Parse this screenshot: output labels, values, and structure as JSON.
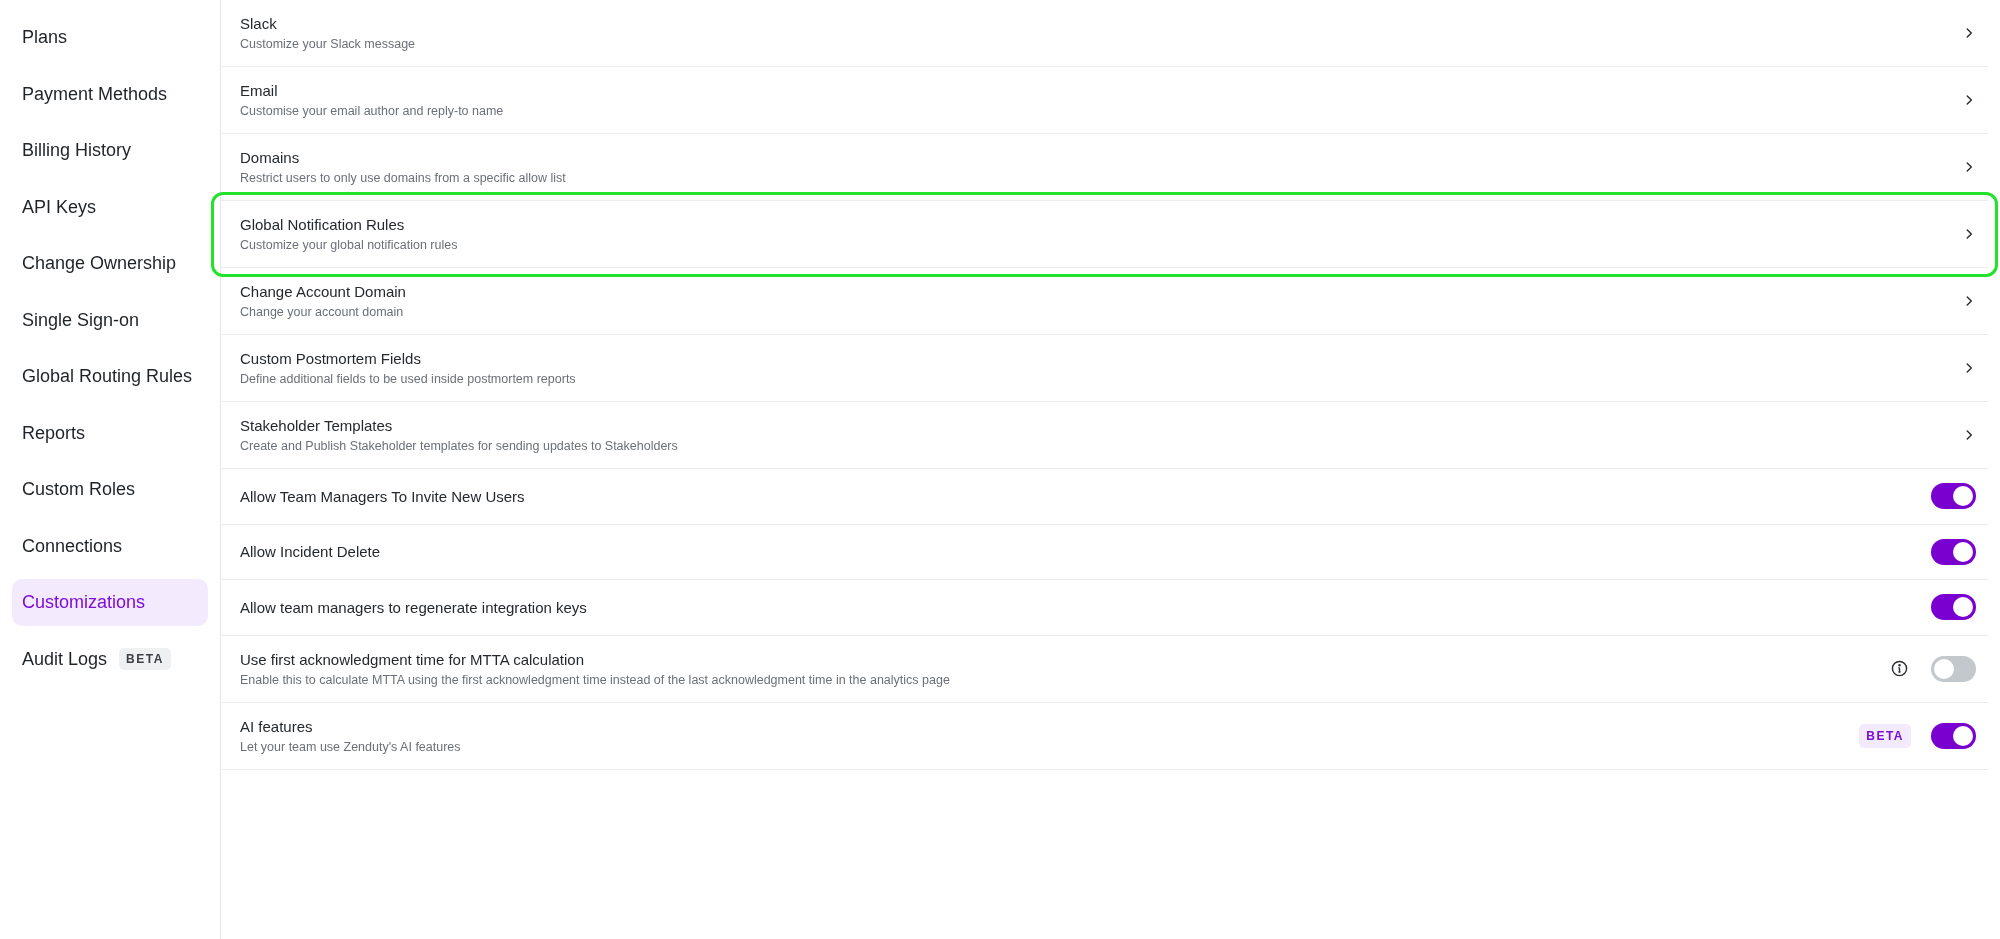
{
  "sidebar": {
    "items": [
      {
        "label": "Plans",
        "selected": false
      },
      {
        "label": "Payment Methods",
        "selected": false
      },
      {
        "label": "Billing History",
        "selected": false
      },
      {
        "label": "API Keys",
        "selected": false
      },
      {
        "label": "Change Ownership",
        "selected": false
      },
      {
        "label": "Single Sign-on",
        "selected": false
      },
      {
        "label": "Global Routing Rules",
        "selected": false
      },
      {
        "label": "Reports",
        "selected": false
      },
      {
        "label": "Custom Roles",
        "selected": false
      },
      {
        "label": "Connections",
        "selected": false
      },
      {
        "label": "Customizations",
        "selected": true
      },
      {
        "label": "Audit Logs",
        "selected": false,
        "badge": "BETA"
      }
    ]
  },
  "settings": [
    {
      "kind": "link",
      "title": "Slack",
      "subtitle": "Customize your Slack message",
      "highlighted": false
    },
    {
      "kind": "link",
      "title": "Email",
      "subtitle": "Customise your email author and reply-to name",
      "highlighted": false
    },
    {
      "kind": "link",
      "title": "Domains",
      "subtitle": "Restrict users to only use domains from a specific allow list",
      "highlighted": false
    },
    {
      "kind": "link",
      "title": "Global Notification Rules",
      "subtitle": "Customize your global notification rules",
      "highlighted": true
    },
    {
      "kind": "link",
      "title": "Change Account Domain",
      "subtitle": "Change your account domain",
      "highlighted": false
    },
    {
      "kind": "link",
      "title": "Custom Postmortem Fields",
      "subtitle": "Define additional fields to be used inside postmortem reports",
      "highlighted": false
    },
    {
      "kind": "link",
      "title": "Stakeholder Templates",
      "subtitle": "Create and Publish Stakeholder templates for sending updates to Stakeholders",
      "highlighted": false
    },
    {
      "kind": "toggle",
      "title": "Allow Team Managers To Invite New Users",
      "on": true
    },
    {
      "kind": "toggle",
      "title": "Allow Incident Delete",
      "on": true
    },
    {
      "kind": "toggle",
      "title": "Allow team managers to regenerate integration keys",
      "on": true
    },
    {
      "kind": "toggle",
      "title": "Use first acknowledgment time for MTTA calculation",
      "subtitle": "Enable this to calculate MTTA using the first acknowledgment time instead of the last acknowledgment time in the analytics page",
      "on": false,
      "info": true
    },
    {
      "kind": "toggle",
      "title": "AI features",
      "subtitle": "Let your team use Zenduty's AI features",
      "on": true,
      "badge": "BETA"
    }
  ]
}
